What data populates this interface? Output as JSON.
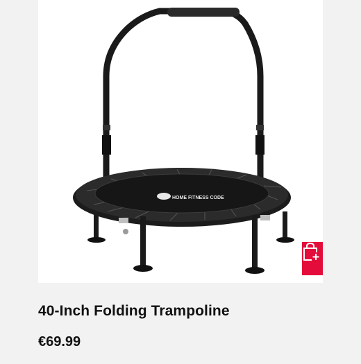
{
  "product": {
    "name": "40-Inch Folding Trampoline",
    "price": "€69.99",
    "image_brand_text": "HOME FITNESS CODE",
    "image_icon": "trampoline-product-image"
  },
  "actions": {
    "add_to_cart_icon": "shopping-bag-plus-icon"
  },
  "colors": {
    "accent": "#e30c3a",
    "background": "#f2f2f2",
    "image_background": "#ffffff",
    "text": "#111111"
  }
}
